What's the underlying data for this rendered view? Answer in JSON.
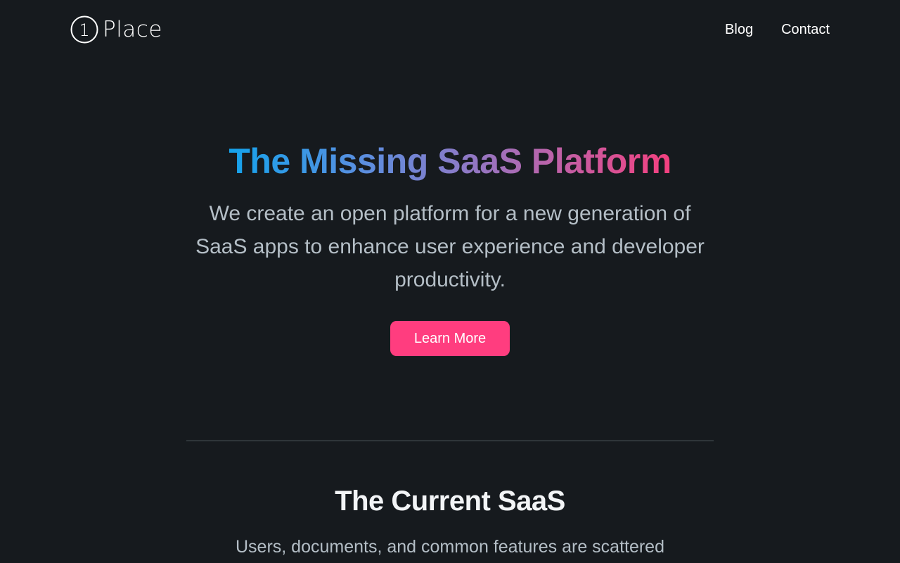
{
  "header": {
    "logo_text": "Place",
    "logo_mark_digit": "1",
    "nav": [
      {
        "label": "Blog"
      },
      {
        "label": "Contact"
      }
    ]
  },
  "hero": {
    "title": "The Missing SaaS Platform",
    "subtitle": "We create an open platform for a new generation of SaaS apps to enhance user experience and developer productivity.",
    "cta_label": "Learn More"
  },
  "section": {
    "title": "The Current SaaS",
    "text": "Users, documents, and common features are scattered"
  },
  "colors": {
    "background": "#161a1e",
    "accent": "#ff3d7f",
    "gradient_start": "#14a3ec",
    "gradient_end": "#f4407f",
    "muted_text": "#b4bec6"
  }
}
